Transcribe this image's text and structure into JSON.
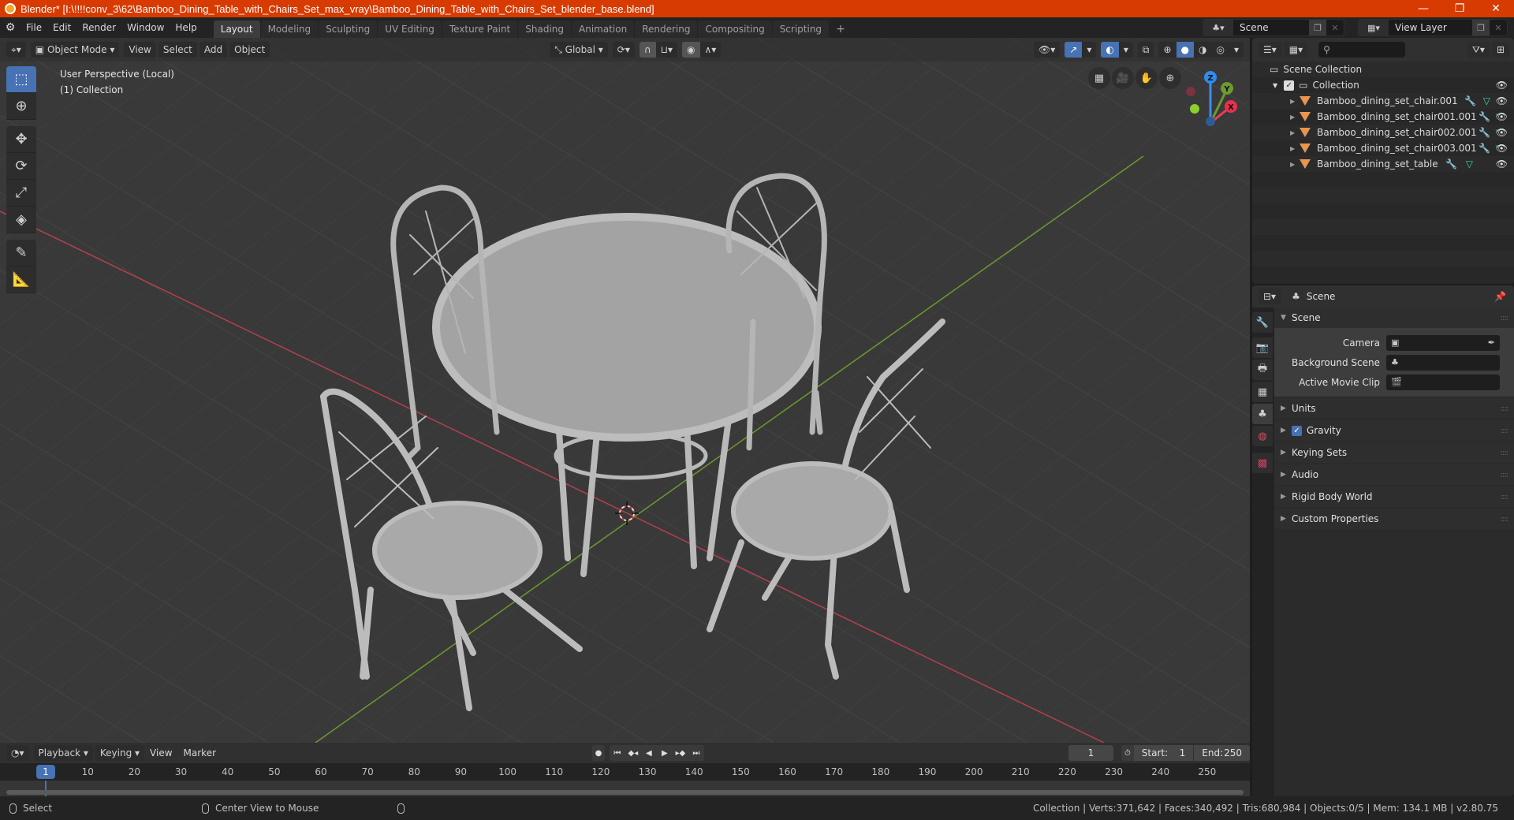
{
  "window": {
    "title": "Blender* [I:\\!!!!conv_3\\62\\Bamboo_Dining_Table_with_Chairs_Set_max_vray\\Bamboo_Dining_Table_with_Chairs_Set_blender_base.blend]",
    "minimize": "—",
    "maximize": "❐",
    "close": "✕"
  },
  "menu": [
    "File",
    "Edit",
    "Render",
    "Window",
    "Help"
  ],
  "workspaces": [
    {
      "label": "Layout",
      "active": true
    },
    {
      "label": "Modeling"
    },
    {
      "label": "Sculpting"
    },
    {
      "label": "UV Editing"
    },
    {
      "label": "Texture Paint"
    },
    {
      "label": "Shading"
    },
    {
      "label": "Animation"
    },
    {
      "label": "Rendering"
    },
    {
      "label": "Compositing"
    },
    {
      "label": "Scripting"
    }
  ],
  "workspace_add": "+",
  "scene_selector": {
    "value": "Scene"
  },
  "view_layer_selector": {
    "value": "View Layer"
  },
  "viewport": {
    "mode": "Object Mode",
    "menus": [
      "View",
      "Select",
      "Add",
      "Object"
    ],
    "transform_orientation": "Global",
    "info_line1": "User Perspective (Local)",
    "info_line2": "(1) Collection",
    "gizmo": {
      "x": "X",
      "y": "Y",
      "z": "Z"
    },
    "colors": {
      "x_axis": "#c4404f",
      "y_axis": "#7aa23a",
      "accent": "#4772b3"
    }
  },
  "outliner": {
    "search_placeholder": "",
    "root": "Scene Collection",
    "collection": "Collection",
    "objects": [
      {
        "name": "Bamboo_dining_set_chair.001"
      },
      {
        "name": "Bamboo_dining_set_chair001.001"
      },
      {
        "name": "Bamboo_dining_set_chair002.001"
      },
      {
        "name": "Bamboo_dining_set_chair003.001"
      },
      {
        "name": "Bamboo_dining_set_table"
      }
    ]
  },
  "properties": {
    "context": "Scene",
    "panel_title": "Scene",
    "fields": [
      {
        "label": "Camera",
        "value": ""
      },
      {
        "label": "Background Scene",
        "value": ""
      },
      {
        "label": "Active Movie Clip",
        "value": ""
      }
    ],
    "subpanels": [
      {
        "label": "Units"
      },
      {
        "label": "Gravity",
        "checked": true
      },
      {
        "label": "Keying Sets"
      },
      {
        "label": "Audio"
      },
      {
        "label": "Rigid Body World"
      },
      {
        "label": "Custom Properties"
      }
    ]
  },
  "timeline": {
    "menus": [
      "Playback",
      "Keying",
      "View",
      "Marker"
    ],
    "current_frame": "1",
    "start_label": "Start:",
    "start": "1",
    "end_label": "End:",
    "end": "250",
    "ruler": [
      "1",
      "10",
      "20",
      "30",
      "40",
      "50",
      "60",
      "70",
      "80",
      "90",
      "100",
      "110",
      "120",
      "130",
      "140",
      "150",
      "160",
      "170",
      "180",
      "190",
      "200",
      "210",
      "220",
      "230",
      "240",
      "250"
    ]
  },
  "statusbar": {
    "left_action": "Select",
    "middle_action": "Center View to Mouse",
    "stats": "Collection | Verts:371,642 | Faces:340,492 | Tris:680,984 | Objects:0/5 | Mem: 134.1 MB | v2.80.75"
  }
}
